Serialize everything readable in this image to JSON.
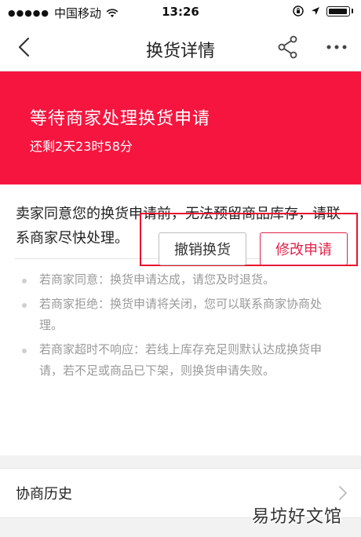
{
  "status_bar": {
    "carrier": "中国移动",
    "time": "13:26"
  },
  "nav": {
    "title": "换货详情"
  },
  "banner": {
    "title": "等待商家处理换货申请",
    "countdown": "还剩2天23时58分"
  },
  "notice": {
    "text": "卖家同意您的换货申请前，无法预留商品库存，请联系商家尽快处理。"
  },
  "tips": [
    "若商家同意：换货申请达成，请您及时退货。",
    "若商家拒绝：换货申请将关闭，您可以联系商家协商处理。",
    "若商家超时不响应：若线上库存充足则默认达成换货申请，若不足或商品已下架，则换货申请失败。"
  ],
  "actions": {
    "cancel_label": "撤销换货",
    "modify_label": "修改申请"
  },
  "history": {
    "label": "协商历史"
  },
  "watermark": "易坊好文馆",
  "colors": {
    "banner": "#f5153f",
    "accent": "#e0234a",
    "highlight_box": "#e8122f"
  }
}
